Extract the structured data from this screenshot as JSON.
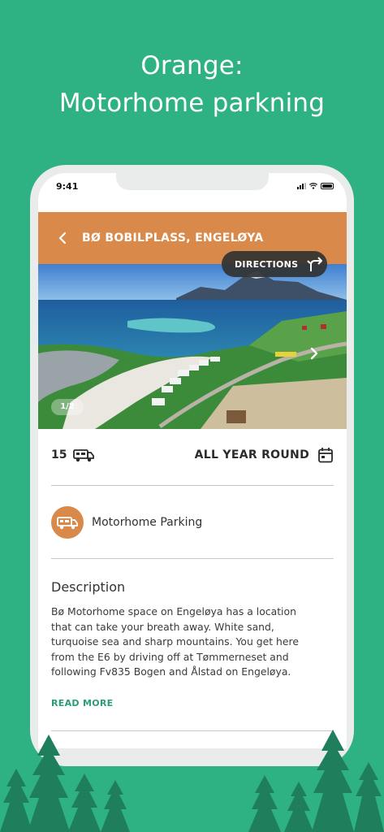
{
  "headline": {
    "line1": "Orange:",
    "line2": "Motorhome parkning"
  },
  "status_bar": {
    "time": "9:41"
  },
  "app_bar": {
    "title": "BØ BOBILPLASS, ENGELØYA",
    "back_icon": "chevron-left-icon"
  },
  "gallery": {
    "directions_label": "DIRECTIONS",
    "directions_icon": "turn-right-arrow-icon",
    "counter": "1/2"
  },
  "info": {
    "capacity": "15",
    "capacity_icon": "motorhome-icon",
    "season": "ALL YEAR ROUND",
    "season_icon": "calendar-icon"
  },
  "type": {
    "label": "Motorhome Parking",
    "icon": "motorhome-icon"
  },
  "description": {
    "heading": "Description",
    "text": "Bø Motorhome space on Engeløya has a location that can take your breath away. White sand, turquoise sea and sharp mountains. You get here from the E6 by driving off at Tømmerneset and following Fv835 Bogen and Ålstad on Engeløya.",
    "read_more": "READ MORE"
  },
  "colors": {
    "background": "#2eb283",
    "accent": "#d98a4b",
    "link": "#2a9d78",
    "tree": "#1f7f5c"
  }
}
